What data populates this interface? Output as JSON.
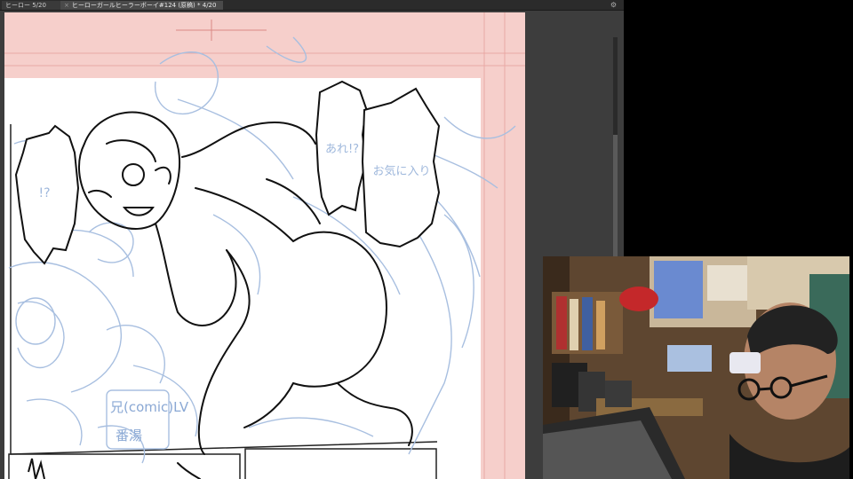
{
  "tabs": [
    {
      "label": "ヒーロー 5/20"
    },
    {
      "label": "ヒーローガールヒーラーボーイ#124 (原稿) * 4/20"
    }
  ],
  "balloons": {
    "left": "!?",
    "right_a": "あれ!?",
    "right_b": "お気に入り"
  },
  "sketch_notes": {
    "line1": "兄(comic)LV",
    "line2": "番湯"
  },
  "colors": {
    "page_bleed": "#f6cfcb",
    "paper": "#ffffff",
    "sketch": "#a8bfe0",
    "ink": "#111111"
  }
}
